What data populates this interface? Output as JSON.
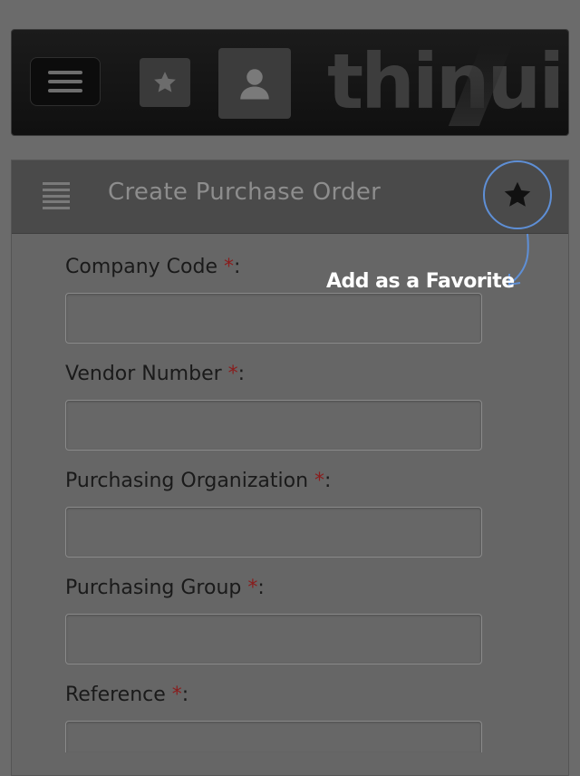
{
  "header": {
    "logo_text": "thinui"
  },
  "panel": {
    "title": "Create Purchase Order"
  },
  "annotation": {
    "text": "Add as a Favorite",
    "circle_color": "#5e8fd6"
  },
  "form": {
    "required_marker": "*",
    "colon": ":",
    "fields": [
      {
        "label": "Company Code",
        "value": ""
      },
      {
        "label": "Vendor Number",
        "value": ""
      },
      {
        "label": "Purchasing Organization",
        "value": ""
      },
      {
        "label": "Purchasing Group",
        "value": ""
      },
      {
        "label": "Reference",
        "value": ""
      }
    ]
  },
  "icons": {
    "menu": "hamburger-icon",
    "favorite": "star-icon",
    "user": "user-icon",
    "list": "list-icon"
  }
}
